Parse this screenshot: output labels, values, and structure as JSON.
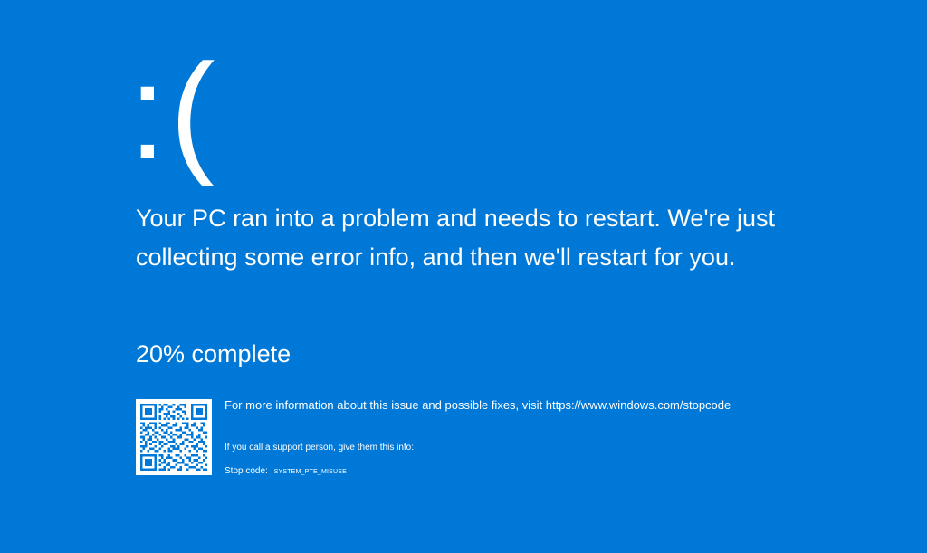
{
  "sad_face": ":(",
  "message": "Your PC ran into a problem and needs to restart. We're just collecting some error info, and then we'll restart for you.",
  "progress": {
    "percent": 20,
    "label": "20% complete"
  },
  "qr": {
    "icon": "qr-code-icon"
  },
  "info": {
    "more_info": "For more information about this issue and possible fixes, visit https://www.windows.com/stopcode",
    "support_text": "If you call a support person, give them this info:",
    "stop_code_label": "Stop code:",
    "stop_code_value": "SYSTEM_PTE_MISUSE"
  },
  "colors": {
    "background": "#0078d7",
    "foreground": "#ffffff"
  }
}
